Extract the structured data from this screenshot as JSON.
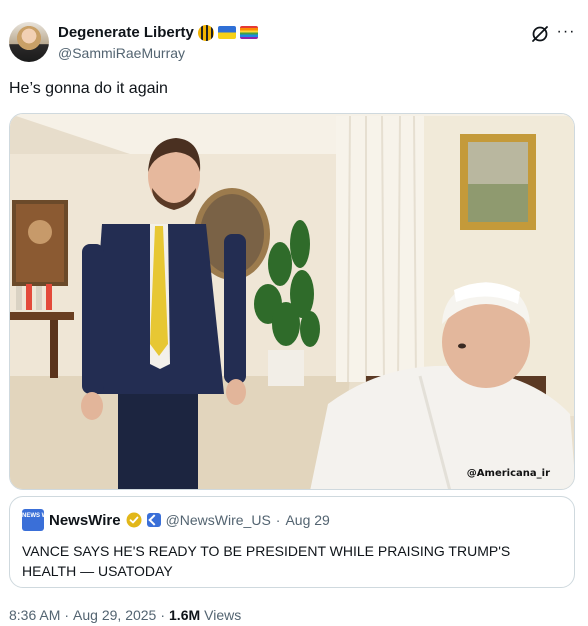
{
  "author": {
    "display_name": "Degenerate Liberty",
    "handle": "@SammiRaeMurray",
    "badges": [
      "bee-emoji",
      "ukraine-flag",
      "rainbow-flag"
    ]
  },
  "tweet": {
    "text": "He’s gonna do it again"
  },
  "media": {
    "watermark": "@Americana_ir"
  },
  "quote": {
    "name": "NewsWire",
    "logo_text": "NEWS WIRE",
    "handle": "@NewsWire_US",
    "separator": "·",
    "date": "Aug 29",
    "text": "VANCE SAYS HE'S READY TO BE PRESIDENT WHILE PRAISING TRUMP'S HEALTH — USATODAY"
  },
  "meta": {
    "time": "8:36 AM",
    "sep1": "·",
    "date": "Aug 29, 2025",
    "sep2": "·",
    "views_count": "1.6M",
    "views_label": "Views"
  },
  "colors": {
    "text": "#0f1419",
    "secondary": "#536471",
    "border": "#cfd9de",
    "verified_gold": "#e2b719",
    "brand_blue": "#3a6fd8"
  }
}
